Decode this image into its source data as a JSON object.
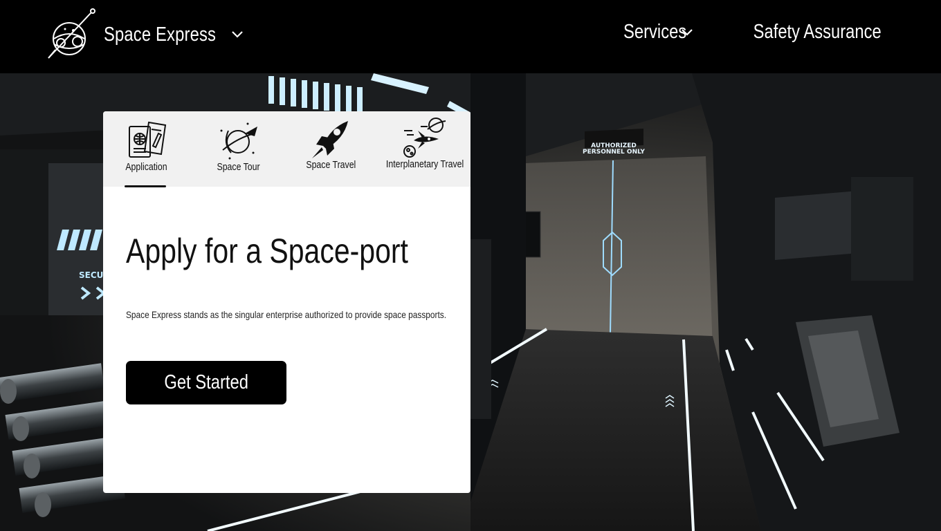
{
  "header": {
    "brand_name": "Space Express",
    "nav": {
      "services_label": "Services",
      "safety_label": "Safety Assurance"
    }
  },
  "card": {
    "tabs": [
      {
        "label": "Application",
        "icon": "passport-icon",
        "active": true
      },
      {
        "label": "Space Tour",
        "icon": "planet-rocket-icon",
        "active": false
      },
      {
        "label": "Space Travel",
        "icon": "rocket-icon",
        "active": false
      },
      {
        "label": "Interplanetary Travel",
        "icon": "spaceship-planets-icon",
        "active": false
      }
    ],
    "title": "Apply for a Space-port",
    "description": "Space Express stands as the singular enterprise authorized to provide space passports.",
    "cta_label": "Get Started"
  },
  "scene": {
    "sign_text": "AUTHORIZED PERSONNEL ONLY",
    "side_sign_text": "SECU"
  },
  "colors": {
    "header_bg": "#000000",
    "card_bg": "#ffffff",
    "tab_bar_bg": "#f1f1f1",
    "cta_bg": "#000000",
    "accent_light": "#bfe9ff"
  }
}
